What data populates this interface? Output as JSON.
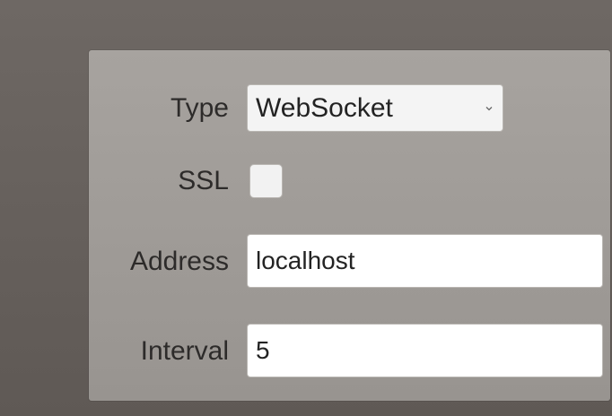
{
  "form": {
    "type": {
      "label": "Type",
      "selected": "WebSocket"
    },
    "ssl": {
      "label": "SSL",
      "checked": false
    },
    "address": {
      "label": "Address",
      "value": "localhost"
    },
    "interval": {
      "label": "Interval",
      "value": "5"
    }
  },
  "icons": {
    "dropdown": "chevron-down-icon"
  },
  "colors": {
    "background": "#6e6864",
    "panel": "#a7a39f",
    "field": "#ffffff",
    "text": "#2d2b2a"
  }
}
